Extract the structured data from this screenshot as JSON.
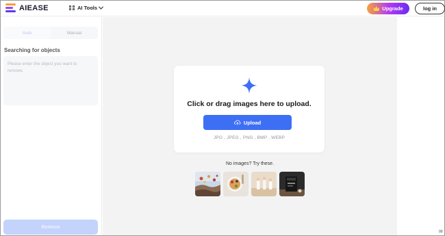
{
  "header": {
    "brand": "AIEASE",
    "ai_tools_label": "AI Tools",
    "upgrade_label": "Upgrade",
    "login_label": "log in"
  },
  "left_panel": {
    "tabs": [
      "Auto",
      "Manual"
    ],
    "active_tab": "Auto",
    "section_title": "Searching for objects",
    "object_input": {
      "value": "",
      "placeholder": "Please enter the object you want to remove."
    },
    "remove_label": "Remove"
  },
  "upload_card": {
    "title": "Click or drag images here to upload.",
    "upload_label": "Upload",
    "formats": "JPG , JPEG , PNG , BMP , WEBP"
  },
  "samples": {
    "prompt": "No images? Try these.",
    "thumbnails": [
      "sample-balloons",
      "sample-food-bowl",
      "sample-people-beach",
      "sample-product"
    ]
  },
  "corner_text": "00",
  "colors": {
    "accent": "#3d6ff5",
    "remove_disabled": "#c4d3fb",
    "main_bg": "#f3f3f3"
  }
}
